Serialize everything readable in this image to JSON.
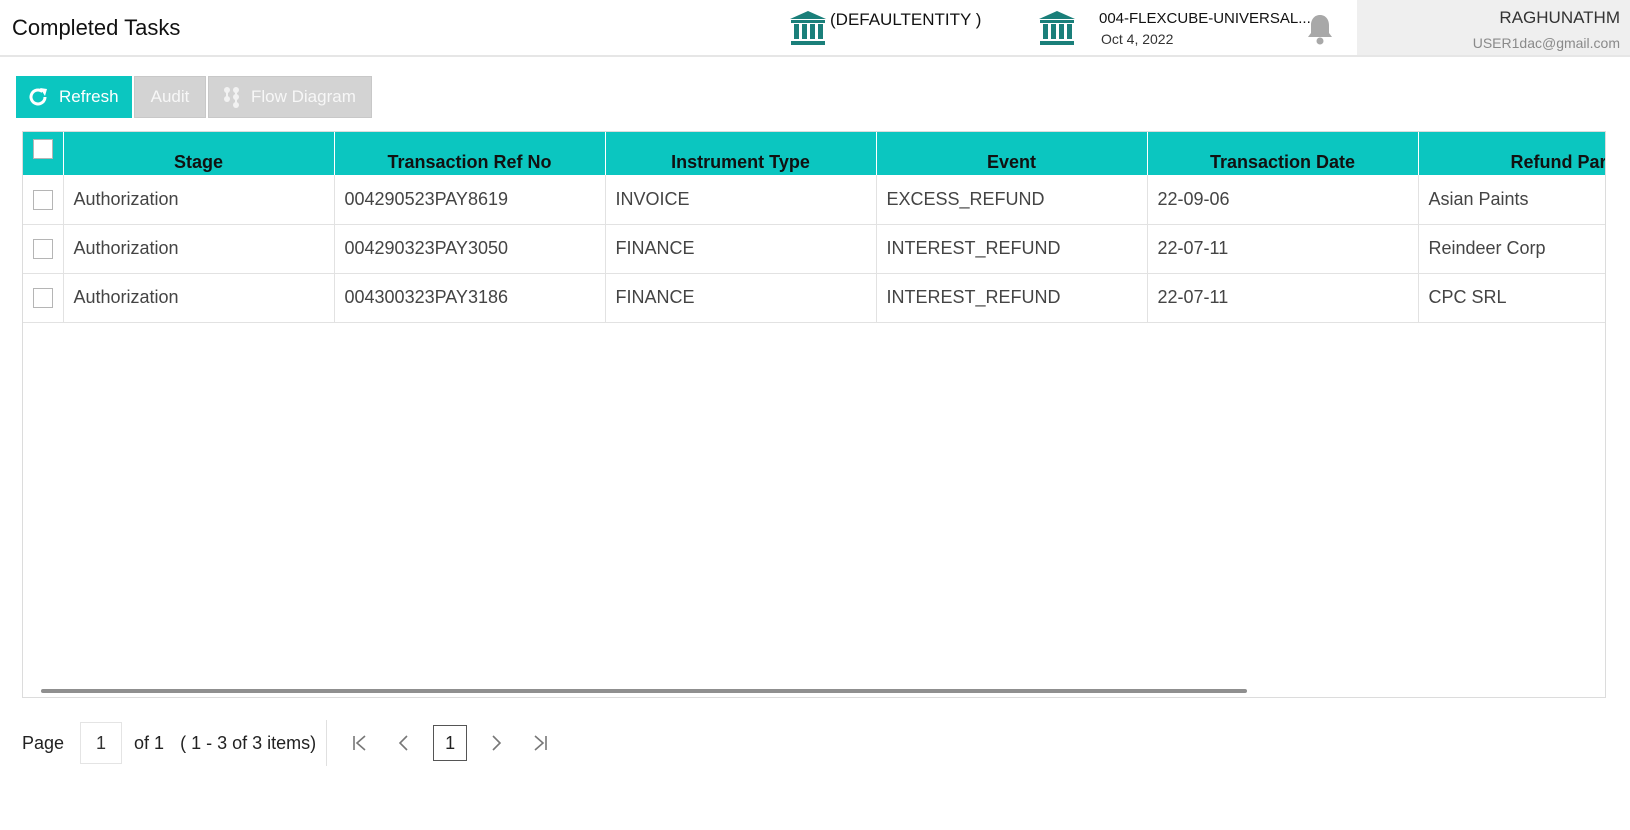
{
  "header": {
    "title": "Completed Tasks",
    "entity": "(DEFAULTENTITY )",
    "branch_name": "004-FLEXCUBE-UNIVERSAL...",
    "branch_date": "Oct 4, 2022",
    "user_name": "RAGHUNATHM",
    "user_email": "USER1dac@gmail.com"
  },
  "toolbar": {
    "refresh_label": "Refresh",
    "audit_label": "Audit",
    "flow_label": "Flow Diagram"
  },
  "table": {
    "columns": [
      "Stage",
      "Transaction Ref No",
      "Instrument Type",
      "Event",
      "Transaction Date",
      "Refund Party"
    ],
    "rows": [
      [
        "Authorization",
        "004290523PAY8619",
        "INVOICE",
        "EXCESS_REFUND",
        "22-09-06",
        "Asian Paints"
      ],
      [
        "Authorization",
        "004290323PAY3050",
        "FINANCE",
        "INTEREST_REFUND",
        "22-07-11",
        "Reindeer Corp"
      ],
      [
        "Authorization",
        "004300323PAY3186",
        "FINANCE",
        "INTEREST_REFUND",
        "22-07-11",
        "CPC SRL"
      ]
    ]
  },
  "pager": {
    "page_label": "Page",
    "page_value": "1",
    "of_label": "of 1",
    "items_label": "( 1 - 3 of 3 items)",
    "current_page": "1"
  },
  "colors": {
    "accent": "#0bc6c0",
    "icon_teal": "#1a7f7a"
  }
}
